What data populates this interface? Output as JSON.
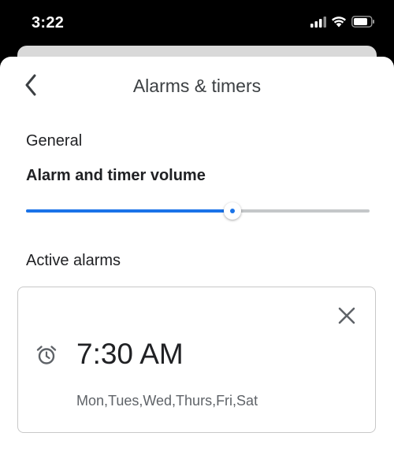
{
  "status_bar": {
    "time": "3:22",
    "icons": [
      "cellular-signal-icon",
      "wifi-icon",
      "battery-icon"
    ]
  },
  "header": {
    "back_icon": "chevron-left-icon",
    "title": "Alarms & timers"
  },
  "general": {
    "section_label": "General",
    "volume_label": "Alarm and timer volume",
    "volume_level": 0.6
  },
  "active_alarms": {
    "section_label": "Active alarms",
    "alarms": [
      {
        "time": "7:30 AM",
        "days": "Mon,Tues,Wed,Thurs,Fri,Sat",
        "icon": "alarm-clock-icon",
        "dismiss_icon": "close-icon"
      }
    ]
  },
  "colors": {
    "accent": "#1a73e8",
    "track": "#c4c7c9",
    "text_primary": "#202124",
    "text_secondary": "#5f6368"
  }
}
